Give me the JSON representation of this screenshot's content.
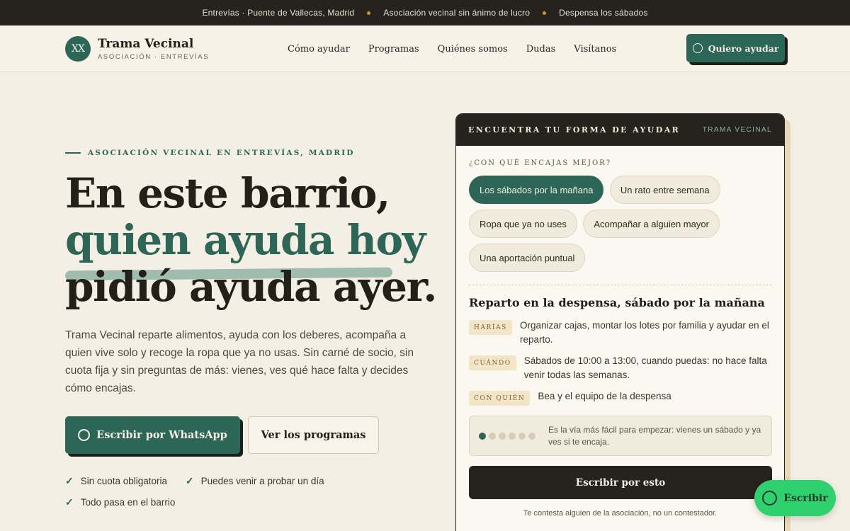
{
  "topbar": {
    "items": [
      "Entrevías · Puente de Vallecas, Madrid",
      "Asociación vecinal sin ánimo de lucro",
      "Despensa los sábados"
    ]
  },
  "nav": {
    "logo_initials": "XX",
    "brand_name": "Trama Vecinal",
    "brand_sub": "ASOCIACIÓN · ENTREVÍAS",
    "menu": [
      "Cómo ayudar",
      "Programas",
      "Quiénes somos",
      "Dudas",
      "Visítanos"
    ],
    "cta_label": "Quiero ayudar"
  },
  "hero": {
    "eyebrow": "ASOCIACIÓN VECINAL EN ENTREVÍAS, MADRID",
    "headline_1": "En este barrio,",
    "headline_2": "quien ayuda hoy",
    "headline_3": "pidió ayuda ayer.",
    "lede": "Trama Vecinal reparte alimentos, ayuda con los deberes, acompaña a quien vive solo y recoge la ropa que ya no usas. Sin carné de socio, sin cuota fija y sin preguntas de más: vienes, ves qué hace falta y decides cómo encajas.",
    "btn_whatsapp": "Escribir por WhatsApp",
    "btn_programs": "Ver los programas",
    "perks": [
      "Sin cuota obligatoria",
      "Puedes venir a probar un día",
      "Todo pasa en el barrio"
    ]
  },
  "card": {
    "title": "ENCUENTRA TU FORMA DE AYUDAR",
    "subtitle": "TRAMA VECINAL",
    "question": "¿CON QUÉ ENCAJAS MEJOR?",
    "chips": [
      "Los sábados por la mañana",
      "Un rato entre semana",
      "Ropa que ya no uses",
      "Acompañar a alguien mayor",
      "Una aportación puntual"
    ],
    "active_chip": "Los sábados por la mañana",
    "program_title": "Reparto en la despensa, sábado por la mañana",
    "details": [
      {
        "tag": "HARÍAS",
        "text": "Organizar cajas, montar los lotes por familia y ayudar en el reparto."
      },
      {
        "tag": "CUÁNDO",
        "text": "Sábados de 10:00 a 13:00, cuando puedas: no hace falta venir todas las semanas."
      },
      {
        "tag": "CON QUIÉN",
        "text": "Bea y el equipo de la despensa"
      }
    ],
    "difficulty_level": 1,
    "difficulty_max": 6,
    "note": "Es la vía más fácil para empezar: vienes un sábado y ya ves si te encaja.",
    "cta": "Escribir por esto",
    "footnote": "Te contesta alguien de la asociación, no un contestador."
  },
  "fab": {
    "label": "Escribir"
  },
  "colors": {
    "accent": "#2d6656",
    "dark": "#26231e",
    "background": "#f4efe4",
    "whatsapp": "#2fd16f"
  },
  "icons": {
    "chat": "chat-bubble-icon",
    "check": "check-icon"
  }
}
